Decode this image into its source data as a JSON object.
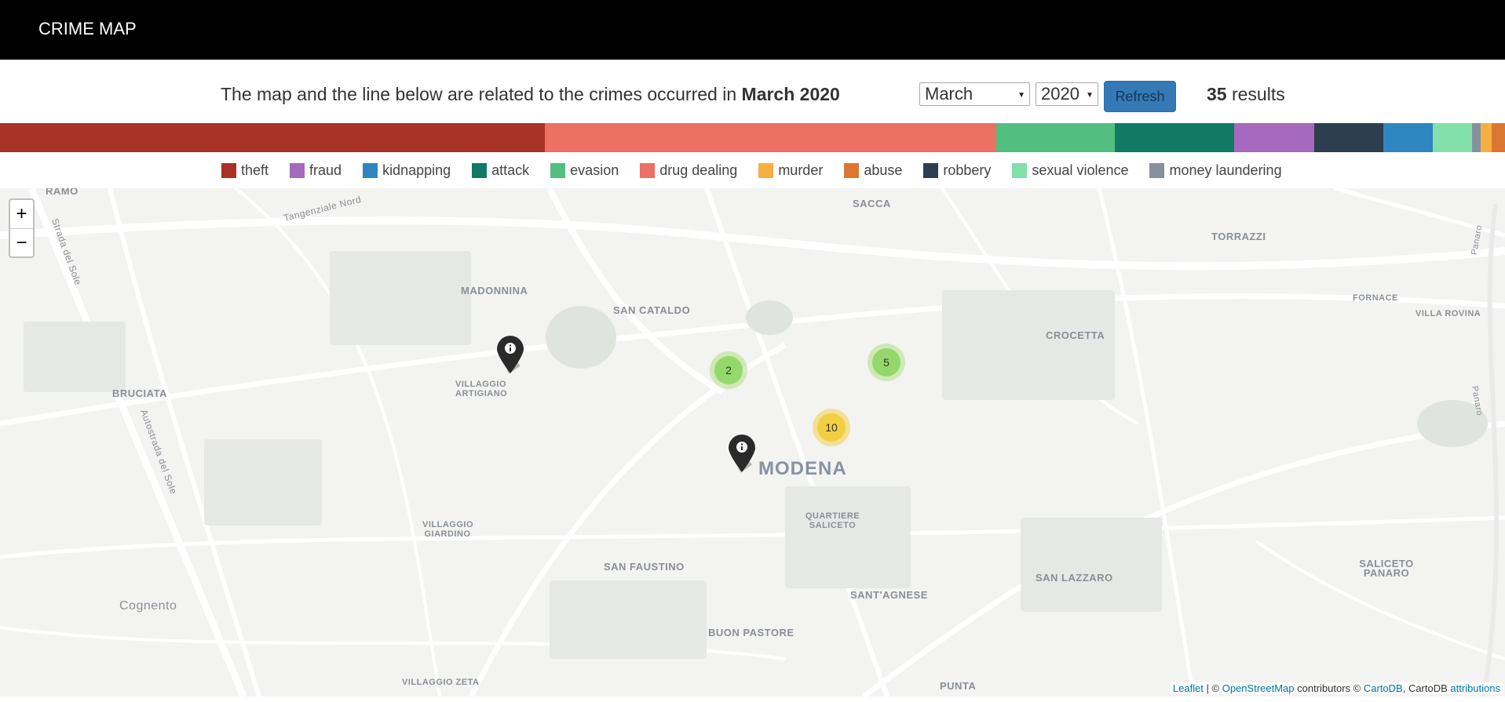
{
  "header": {
    "title": "CRIME MAP"
  },
  "intro": {
    "text": "The map and the line below are related to the crimes occurred in ",
    "period": "March 2020"
  },
  "filters": {
    "month": "March",
    "year": "2020",
    "refresh_label": "Refresh"
  },
  "results": {
    "count": "35",
    "label": " results"
  },
  "crime_distribution": [
    {
      "category": "theft",
      "color": "#a93226",
      "share": 0.362
    },
    {
      "category": "drug dealing",
      "color": "#ec7063",
      "share": 0.3
    },
    {
      "category": "evasion",
      "color": "#52be80",
      "share": 0.079
    },
    {
      "category": "attack",
      "color": "#117a65",
      "share": 0.079
    },
    {
      "category": "fraud",
      "color": "#a569bd",
      "share": 0.053
    },
    {
      "category": "robbery",
      "color": "#2c3e50",
      "share": 0.046
    },
    {
      "category": "kidnapping",
      "color": "#2e86c1",
      "share": 0.033
    },
    {
      "category": "sexual violence",
      "color": "#82e0aa",
      "share": 0.026
    },
    {
      "category": "money laundering",
      "color": "#85929e",
      "share": 0.006
    },
    {
      "category": "murder",
      "color": "#f5b041",
      "share": 0.007
    },
    {
      "category": "abuse",
      "color": "#dc7633",
      "share": 0.009
    }
  ],
  "legend": [
    {
      "label": "theft",
      "color": "#a93226"
    },
    {
      "label": "fraud",
      "color": "#a569bd"
    },
    {
      "label": "kidnapping",
      "color": "#2e86c1"
    },
    {
      "label": "attack",
      "color": "#117a65"
    },
    {
      "label": "evasion",
      "color": "#52be80"
    },
    {
      "label": "drug dealing",
      "color": "#ec7063"
    },
    {
      "label": "murder",
      "color": "#f5b041"
    },
    {
      "label": "abuse",
      "color": "#dc7633"
    },
    {
      "label": "robbery",
      "color": "#2c3e50"
    },
    {
      "label": "sexual violence",
      "color": "#82e0aa"
    },
    {
      "label": "money laundering",
      "color": "#85929e"
    }
  ],
  "map": {
    "zoom_in": "+",
    "zoom_out": "−",
    "places": {
      "ramo": "RAMO",
      "sacca": "SACCA",
      "torrazzi": "TORRAZZI",
      "madonnina": "MADONNINA",
      "san_cataldo": "SAN CATALDO",
      "fornace": "FORNACE",
      "villa_rovina": "VILLA ROVINA",
      "crocetta": "CROCETTA",
      "villaggio_artigiano": "VILLAGGIO ARTIGIANO",
      "bruciata": "BRUCIATA",
      "modena": "MODENA",
      "quartiere_saliceto": "QUARTIERE SALICETO",
      "villaggio_giardino": "VILLAGGIO GIARDINO",
      "san_faustino": "SAN FAUSTINO",
      "san_lazzaro": "SAN LAZZARO",
      "saliceto_panaro": "SALICETO PANARO",
      "santagnese": "SANT'AGNESE",
      "cognento": "Cognento",
      "buon_pastore": "BUON PASTORE",
      "villaggio_zeta": "VILLAGGIO ZETA",
      "punta": "PUNTA",
      "tangenziale": "Tangenziale Nord",
      "autostrada1": "Strada del Sole",
      "autostrada2": "Autostrada del Sole",
      "panaro1": "Panaro",
      "panaro2": "Panaro"
    },
    "clusters": [
      {
        "count": "2",
        "tone": "green"
      },
      {
        "count": "5",
        "tone": "green"
      },
      {
        "count": "10",
        "tone": "yellow"
      }
    ],
    "pins": [
      {
        "icon": "info-icon"
      },
      {
        "icon": "info-icon"
      }
    ],
    "attribution": {
      "leaflet": "Leaflet",
      "sep1": " | © ",
      "osm": "OpenStreetMap",
      "contrib": " contributors © ",
      "cartodb": "CartoDB",
      "sep2": ", CartoDB ",
      "attributions": "attributions"
    }
  }
}
